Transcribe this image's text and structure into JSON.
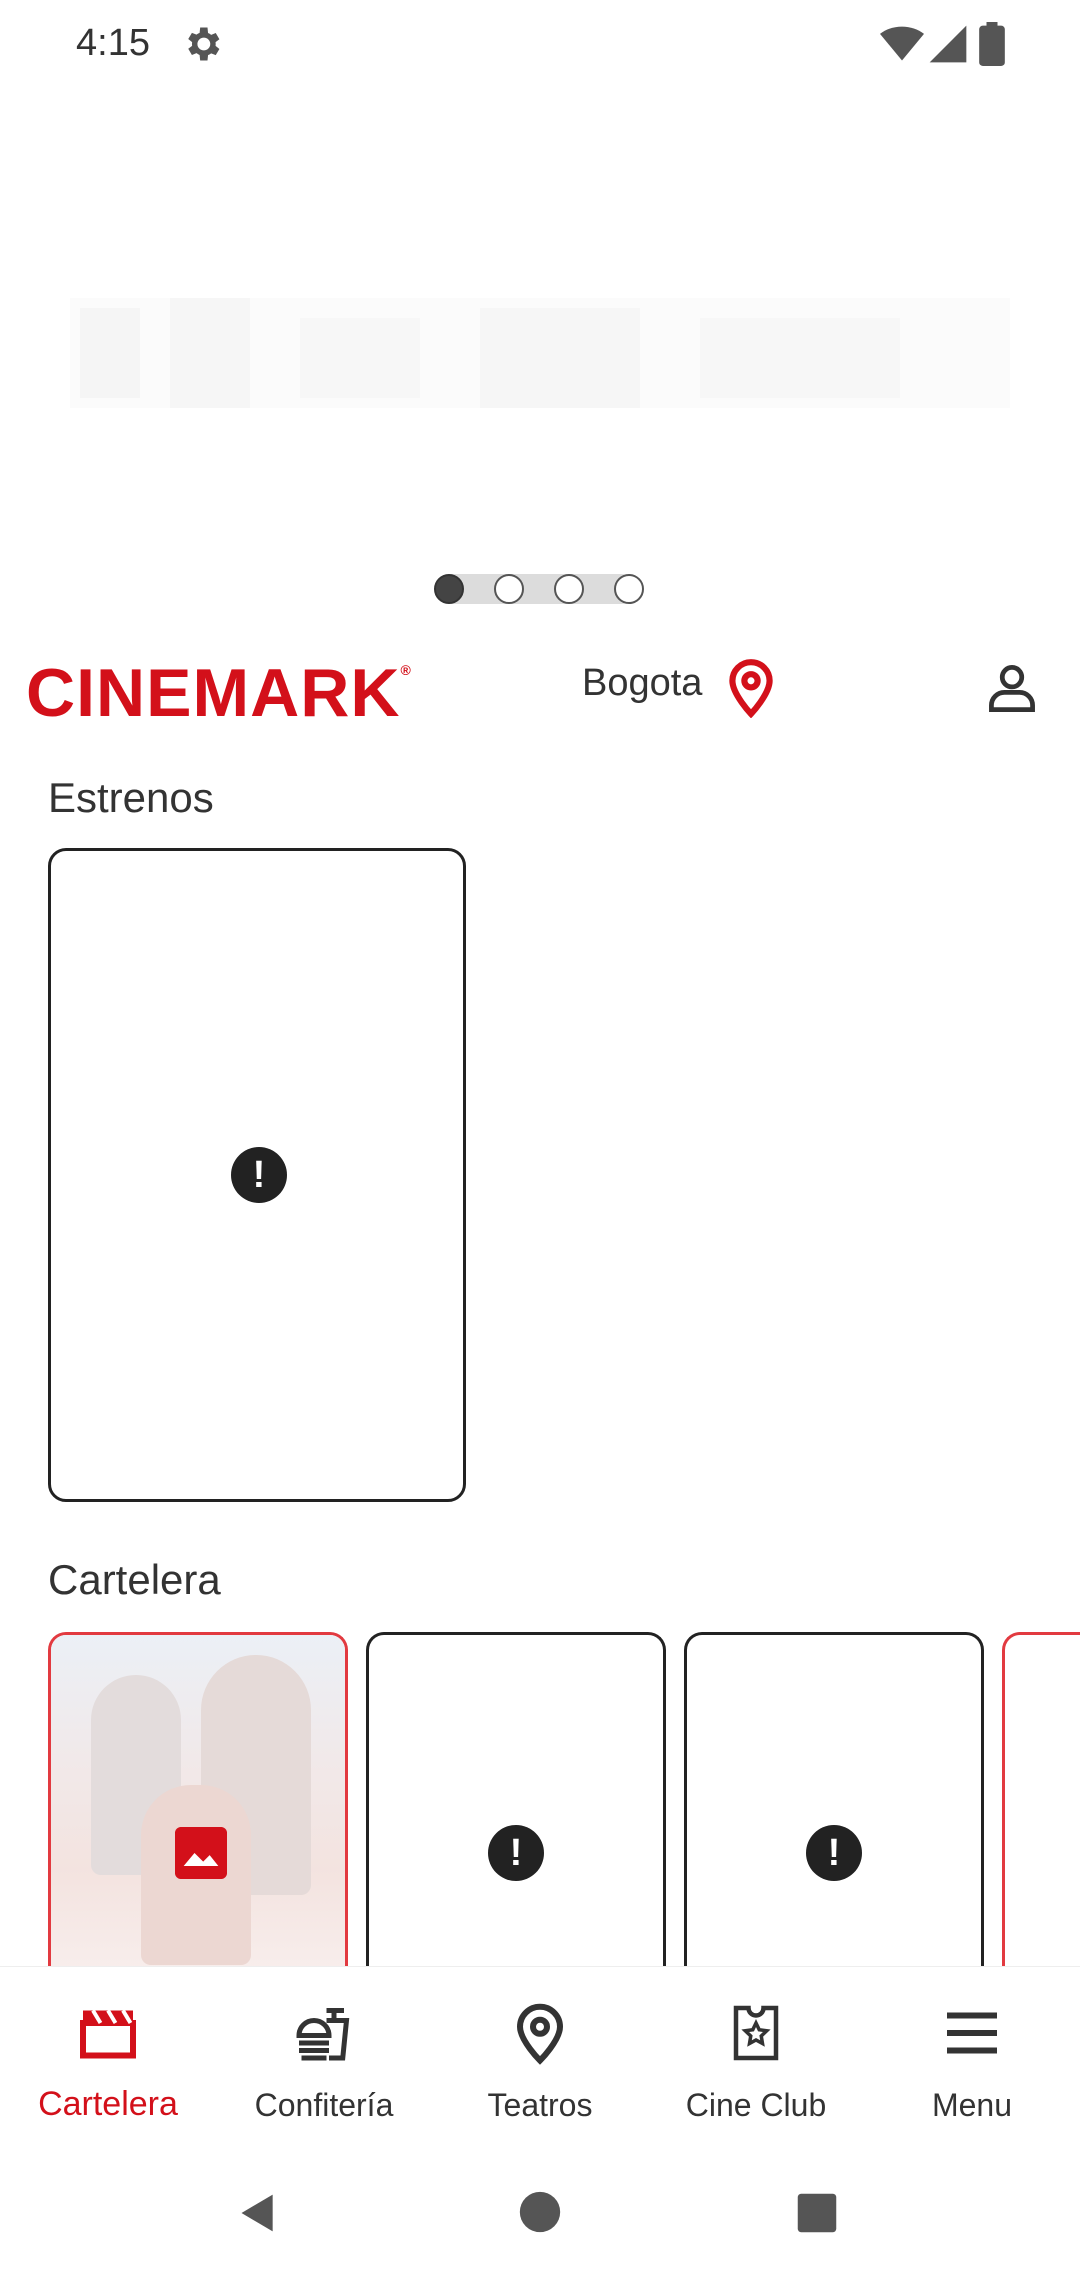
{
  "status_bar": {
    "time": "4:15",
    "icons": [
      "gear-icon",
      "wifi-icon",
      "signal-icon",
      "battery-icon"
    ]
  },
  "hero": {
    "carousel_dots": 4,
    "active_dot": 0
  },
  "header": {
    "logo_text": "CINEMARK",
    "logo_mark": "®",
    "city": "Bogota",
    "brand_color": "#d3101a"
  },
  "sections": {
    "estrenos": {
      "title": "Estrenos"
    },
    "cartelera": {
      "title": "Cartelera"
    }
  },
  "bottom_nav": {
    "items": [
      {
        "label": "Cartelera",
        "icon": "clapperboard-icon",
        "active": true
      },
      {
        "label": "Confitería",
        "icon": "food-icon",
        "active": false
      },
      {
        "label": "Teatros",
        "icon": "location-pin-icon",
        "active": false
      },
      {
        "label": "Cine Club",
        "icon": "ticket-star-icon",
        "active": false
      },
      {
        "label": "Menu",
        "icon": "hamburger-menu-icon",
        "active": false
      }
    ]
  },
  "system_nav": {
    "icons": [
      "back-icon",
      "home-icon",
      "recents-icon"
    ]
  }
}
